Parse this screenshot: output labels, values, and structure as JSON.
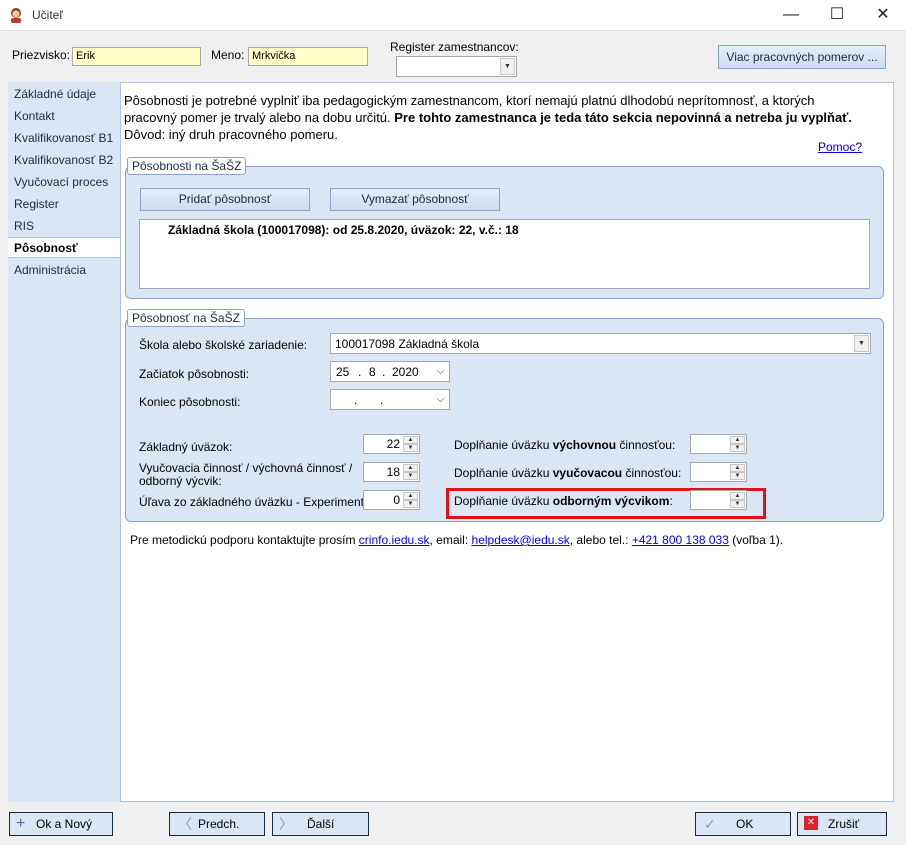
{
  "window": {
    "title": "Učiteľ",
    "min": "—",
    "max": "☐",
    "close": "✕"
  },
  "header": {
    "surname_label": "Priezvisko:",
    "surname_value": "Erik",
    "name_label": "Meno:",
    "name_value": "Mrkvička",
    "register_label": "Register zamestnancov:",
    "register_value": "",
    "more_button": "Viac pracovných pomerov ..."
  },
  "sidebar": {
    "items": [
      {
        "label": "Základné údaje"
      },
      {
        "label": "Kontakt"
      },
      {
        "label": "Kvalifikovanosť B1"
      },
      {
        "label": "Kvalifikovanosť B2"
      },
      {
        "label": "Vyučovací proces"
      },
      {
        "label": "Register"
      },
      {
        "label": "RIS"
      },
      {
        "label": "Pôsobnosť"
      },
      {
        "label": "Administrácia"
      }
    ],
    "active_index": 7
  },
  "main": {
    "info_text": "Pôsobnosti je potrebné vyplniť iba pedagogickým zamestnancom, ktorí nemajú platnú dlhodobú neprítomnosť, a ktorých pracovný pomer je trvalý alebo na dobu určitú. ",
    "info_bold": "Pre tohto zamestnanca je teda táto sekcia nepovinná a netreba ju vyplňať.",
    "info_tail": " Dôvod: iný druh pracovného pomeru.",
    "help_link": "Pomoc?",
    "group1": {
      "title": "Pôsobnosti na ŠaŠZ",
      "add_button": "Pridať pôsobnosť",
      "delete_button": "Vymazať pôsobnosť",
      "items": [
        "Základná škola (100017098): od 25.8.2020, úväzok: 22, v.č.: 18"
      ]
    },
    "group2": {
      "title": "Pôsobnosť na ŠaŠZ",
      "school_label": "Škola alebo školské zariadenie:",
      "school_value": "100017098 Základná škola",
      "start_label": "Začiatok pôsobnosti:",
      "start_day": "25",
      "start_month": "8",
      "start_year": "2020",
      "end_label": "Koniec pôsobnosti:",
      "sep": ".",
      "basic_label": "Základný úväzok:",
      "basic_value": "22",
      "teaching_label1": "Vyučovacia činnosť / výchovná činnosť /",
      "teaching_label2": "odborný výcvik:",
      "teaching_value": "18",
      "relief_label": "Úľava zo základného úväzku - Experiment:",
      "relief_value": "0",
      "fill1_pre": "Doplňanie úväzku ",
      "fill1_bold": "výchovnou",
      "fill1_post": " činnosťou:",
      "fill2_pre": "Doplňanie úväzku ",
      "fill2_bold": "vyučovacou",
      "fill2_post": " činnosťou:",
      "fill3_pre": "Doplňanie úväzku ",
      "fill3_bold": "odborným výcvikom",
      "fill3_post": ":"
    },
    "support": {
      "pre": "Pre metodickú podporu kontaktujte prosím ",
      "link1": "crinfo.iedu.sk",
      "mid1": ", email: ",
      "link2": "helpdesk@iedu.sk",
      "mid2": ", alebo tel.: ",
      "link3": "+421 800 138 033",
      "post": " (voľba 1)."
    }
  },
  "footer": {
    "ok_new": "Ok a Nový",
    "prev": "Predch.",
    "next": "Ďalší",
    "ok": "OK",
    "cancel": "Zrušiť"
  },
  "colors": {
    "highlight": "#e0101a",
    "panel": "#dbe6f4",
    "input_yellow": "#ffffc8"
  }
}
